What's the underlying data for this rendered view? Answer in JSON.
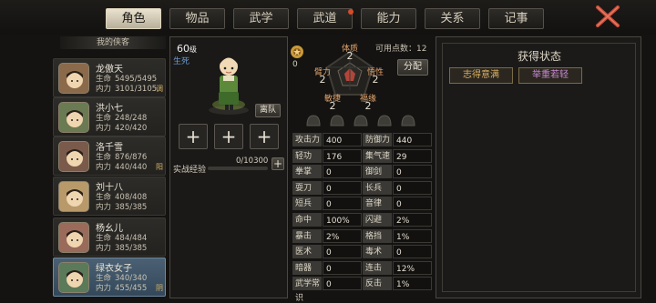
{
  "tabs": [
    {
      "label": "角色",
      "active": true
    },
    {
      "label": "物品",
      "active": false
    },
    {
      "label": "武学",
      "active": false
    },
    {
      "label": "武道",
      "active": false,
      "badge": true
    },
    {
      "label": "能力",
      "active": false
    },
    {
      "label": "关系",
      "active": false
    },
    {
      "label": "记事",
      "active": false
    }
  ],
  "sidebar": {
    "title": "我的侠客",
    "characters": [
      {
        "name": "龙傲天",
        "hp_label": "生命",
        "hp": "5495/5495",
        "mp_label": "内力",
        "mp": "3101/3105",
        "tag": "调",
        "avatar_color": "#8a6a4a"
      },
      {
        "name": "洪小七",
        "hp_label": "生命",
        "hp": "248/248",
        "mp_label": "内力",
        "mp": "420/420",
        "tag": "",
        "avatar_color": "#6a7a52"
      },
      {
        "name": "洛千雪",
        "hp_label": "生命",
        "hp": "876/876",
        "mp_label": "内力",
        "mp": "440/440",
        "tag": "阳",
        "avatar_color": "#7a5a4a"
      },
      {
        "name": "刘十八",
        "hp_label": "生命",
        "hp": "408/408",
        "mp_label": "内力",
        "mp": "385/385",
        "tag": "",
        "avatar_color": "#b89a6a"
      },
      {
        "name": "杨幺儿",
        "hp_label": "生命",
        "hp": "484/484",
        "mp_label": "内力",
        "mp": "385/385",
        "tag": "",
        "avatar_color": "#9a6a5a"
      },
      {
        "name": "绿衣女子",
        "hp_label": "生命",
        "hp": "340/340",
        "mp_label": "内力",
        "mp": "455/455",
        "tag": "阴",
        "avatar_color": "#5a7a5a",
        "selected": true
      }
    ]
  },
  "hero": {
    "level_num": "60",
    "level_unit": "级",
    "status": "生死",
    "leave_btn": "离队",
    "exp_label": "实战经验",
    "exp_value": "0/10300",
    "exp_progress": 0,
    "skill_count": "0"
  },
  "attributes": {
    "tizhi_label": "体质",
    "tizhi": "2",
    "biili_label": "臂力",
    "biili": "2",
    "wuxing_label": "悟性",
    "wuxing": "2",
    "minjie_label": "敏捷",
    "minjie": "2",
    "fuyuan_label": "福缘",
    "fuyuan": "2",
    "points_label": "可用点数：",
    "points": "12",
    "assign_btn": "分配"
  },
  "stats": {
    "left": [
      {
        "label": "攻击力",
        "value": "400"
      },
      {
        "label": "轻功",
        "value": "176"
      },
      {
        "label": "拳掌",
        "value": "0"
      },
      {
        "label": "耍刀",
        "value": "0"
      },
      {
        "label": "短兵",
        "value": "0"
      },
      {
        "label": "命中",
        "value": "100%"
      },
      {
        "label": "暴击",
        "value": "2%"
      },
      {
        "label": "医术",
        "value": "0"
      },
      {
        "label": "暗器",
        "value": "0"
      },
      {
        "label": "武学常识",
        "value": "0"
      }
    ],
    "right": [
      {
        "label": "防御力",
        "value": "440"
      },
      {
        "label": "集气速度",
        "value": "29"
      },
      {
        "label": "御剑",
        "value": "0"
      },
      {
        "label": "长兵",
        "value": "0"
      },
      {
        "label": "音律",
        "value": "0"
      },
      {
        "label": "闪避",
        "value": "2%"
      },
      {
        "label": "格挡",
        "value": "1%"
      },
      {
        "label": "毒术",
        "value": "0"
      },
      {
        "label": "连击",
        "value": "12%"
      },
      {
        "label": "反击",
        "value": "1%"
      }
    ]
  },
  "status_panel": {
    "title": "获得状态",
    "items": [
      {
        "label": "志得意满",
        "color": "#d9b063"
      },
      {
        "label": "举重若轻",
        "color": "#c98ad3"
      }
    ]
  }
}
